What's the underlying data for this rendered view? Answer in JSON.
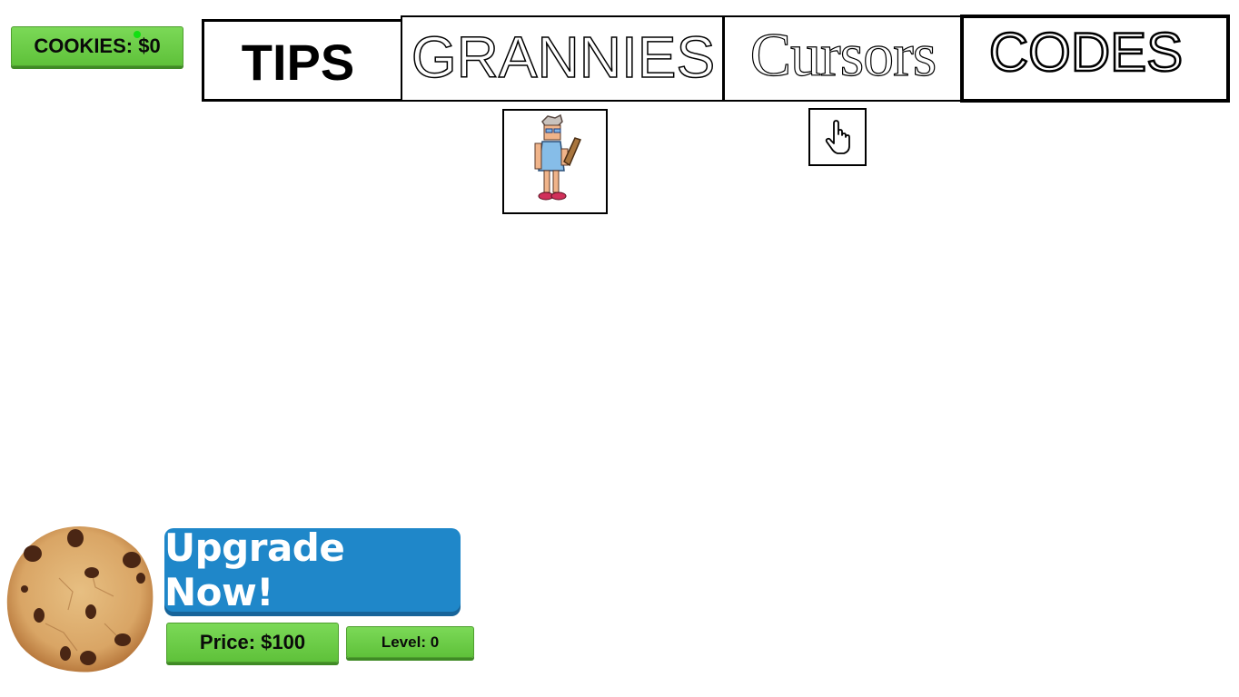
{
  "header": {
    "cookies_label": "COOKIES: $0"
  },
  "tabs": [
    {
      "label": "TIPS"
    },
    {
      "label": "GRANNIES"
    },
    {
      "label": "Cursors"
    },
    {
      "label": "CODES"
    }
  ],
  "items": {
    "granny_icon": "granny-sprite-icon",
    "cursor_icon": "hand-pointer-icon"
  },
  "bottom": {
    "cookie_icon": "chocolate-chip-cookie",
    "upgrade_label": "Upgrade Now!",
    "price_label": "Price: $100",
    "level_label": "Level: 0"
  },
  "colors": {
    "green_button": "#6bcd48",
    "upgrade_blue": "#1f87c9"
  }
}
